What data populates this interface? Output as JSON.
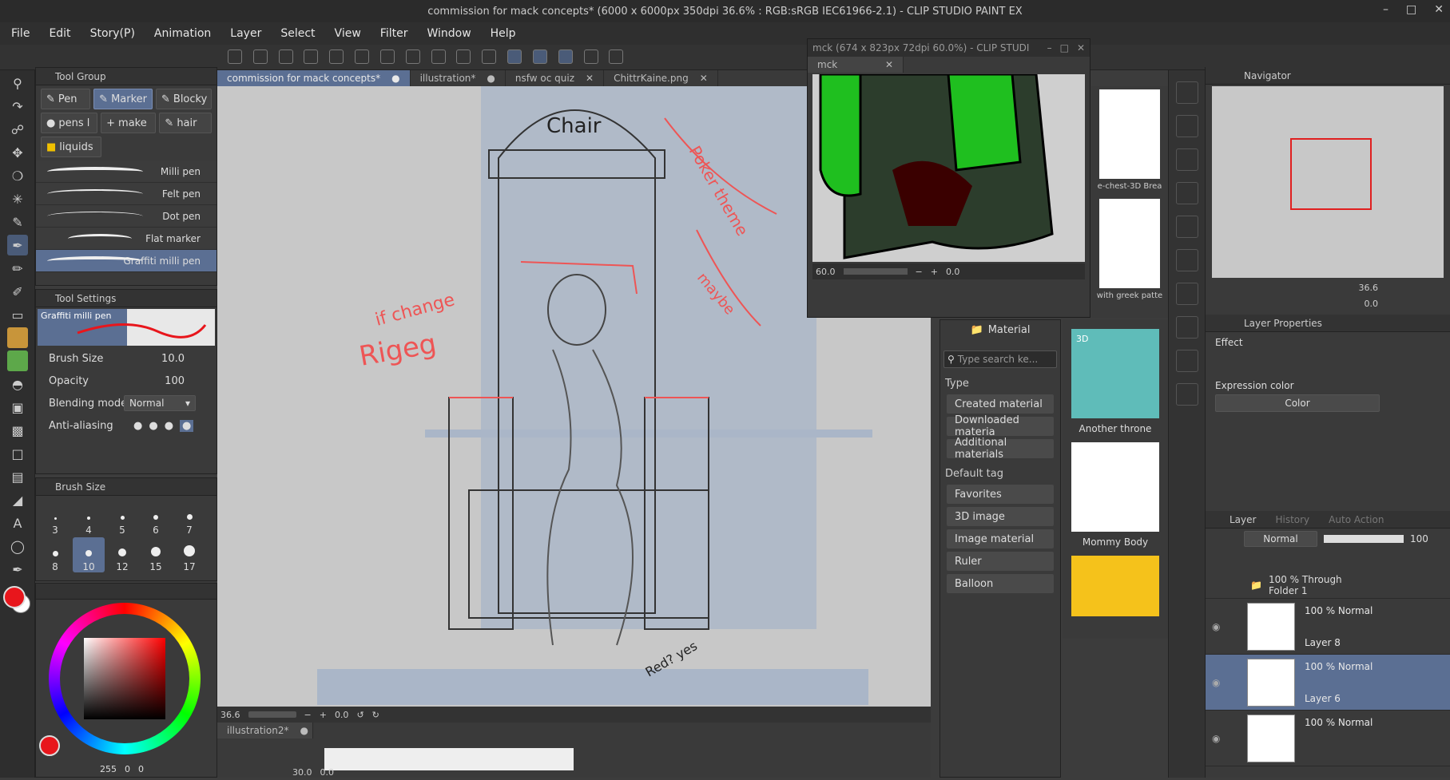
{
  "window": {
    "title": "commission for mack concepts* (6000 x 6000px 350dpi 36.6% : RGB:sRGB IEC61966-2.1) - CLIP STUDIO PAINT EX"
  },
  "menu": [
    "File",
    "Edit",
    "Story(P)",
    "Animation",
    "Layer",
    "Select",
    "View",
    "Filter",
    "Window",
    "Help"
  ],
  "tool_group": {
    "title": "Tool Group",
    "tabs": [
      "Pen",
      "Marker",
      "Blocky",
      "pens l",
      "make",
      "hair",
      "liquids"
    ],
    "selected": "Marker"
  },
  "brushes": [
    "Milli pen",
    "Felt pen",
    "Dot pen",
    "Flat marker",
    "Graffiti milli pen"
  ],
  "selected_brush": "Graffiti milli pen",
  "tool_settings": {
    "title": "Tool Settings",
    "brush_name": "Graffiti milli pen",
    "brush_size_label": "Brush Size",
    "brush_size_value": "10.0",
    "opacity_label": "Opacity",
    "opacity_value": "100",
    "blending_label": "Blending mode",
    "blending_value": "Normal",
    "antialias_label": "Anti-aliasing"
  },
  "brush_size_panel": {
    "title": "Brush Size",
    "sizes": [
      "3",
      "4",
      "5",
      "6",
      "7",
      "8",
      "10",
      "12",
      "15",
      "17"
    ],
    "selected": "10"
  },
  "color": {
    "main": "#e8161c",
    "r": "255",
    "g": "0",
    "b": "0"
  },
  "doc_tabs": [
    {
      "label": "commission for mack concepts*",
      "selected": true
    },
    {
      "label": "illustration*",
      "selected": false
    },
    {
      "label": "nsfw oc quiz",
      "selected": false
    },
    {
      "label": "ChittrKaine.png",
      "selected": false
    }
  ],
  "canvas": {
    "zoom": "36.6",
    "rotation": "0.0",
    "sketch_labels": [
      "Chair",
      "Poker theme",
      "if change",
      "Rigeg",
      "maybe",
      "Red? yes"
    ]
  },
  "secondary_doc": {
    "tab": "illustration2*",
    "zoom": "30.0",
    "rotation": "0.0"
  },
  "subwindow": {
    "title": "mck (674 x 823px 72dpi 60.0%) - CLIP STUDI",
    "tab": "mck",
    "zoom": "60.0",
    "rotation": "0.0"
  },
  "material": {
    "title": "Material",
    "search_placeholder": "Type search ke...",
    "type_label": "Type",
    "types": [
      "Created material",
      "Downloaded materia",
      "Additional materials"
    ],
    "default_tag_label": "Default tag",
    "tags": [
      "Favorites",
      "3D image",
      "Image material",
      "Ruler",
      "Balloon"
    ],
    "thumbs_left": [
      {
        "label": "e-chest-3D Brea"
      },
      {
        "label": "with greek patte"
      }
    ],
    "thumbs": [
      {
        "label": "Another throne",
        "badge": "3D"
      },
      {
        "label": "Mommy Body"
      },
      {
        "label": ""
      }
    ]
  },
  "navigator": {
    "title": "Navigator",
    "zoom": "36.6",
    "rotation": "0.0"
  },
  "layer_properties": {
    "title": "Layer Properties",
    "effect_label": "Effect",
    "expression_label": "Expression color",
    "expression_value": "Color"
  },
  "layer_panel": {
    "tabs": [
      "Layer",
      "History",
      "Auto Action"
    ],
    "blend_mode": "Normal",
    "opacity": "100",
    "layers": [
      {
        "mode": "100 % Through",
        "name": "Folder 1",
        "type": "folder",
        "selected": false
      },
      {
        "mode": "100 % Normal",
        "name": "Layer 8",
        "type": "raster",
        "selected": false
      },
      {
        "mode": "100 % Normal",
        "name": "Layer 6",
        "type": "raster",
        "selected": true
      },
      {
        "mode": "100 % Normal",
        "name": "",
        "type": "raster",
        "selected": false
      }
    ]
  }
}
